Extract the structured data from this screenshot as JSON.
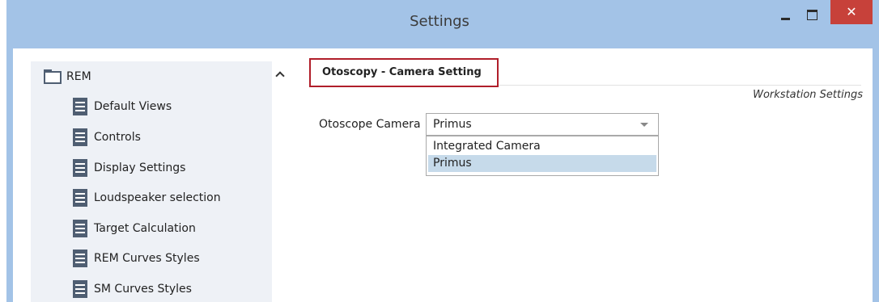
{
  "window": {
    "title": "Settings",
    "minimize_label": "",
    "close_label": "✕"
  },
  "sidebar": {
    "root": {
      "label": "REM",
      "expanded": true
    },
    "items": [
      {
        "label": "Default Views"
      },
      {
        "label": "Controls"
      },
      {
        "label": "Display Settings"
      },
      {
        "label": "Loudspeaker selection"
      },
      {
        "label": "Target Calculation"
      },
      {
        "label": "REM Curves Styles"
      },
      {
        "label": "SM Curves Styles"
      }
    ]
  },
  "content": {
    "section_title": "Otoscopy - Camera Setting",
    "scope_label": "Workstation Settings",
    "camera_field": {
      "label": "Otoscope Camera",
      "value": "Primus",
      "options": [
        "Integrated Camera",
        "Primus"
      ],
      "selected_index": 1
    }
  },
  "colors": {
    "title_bar": "#a3c3e7",
    "close_button": "#c7413a",
    "highlight_border": "#b01e2a",
    "selected_option": "#c6daea",
    "icon": "#4f5e72"
  }
}
